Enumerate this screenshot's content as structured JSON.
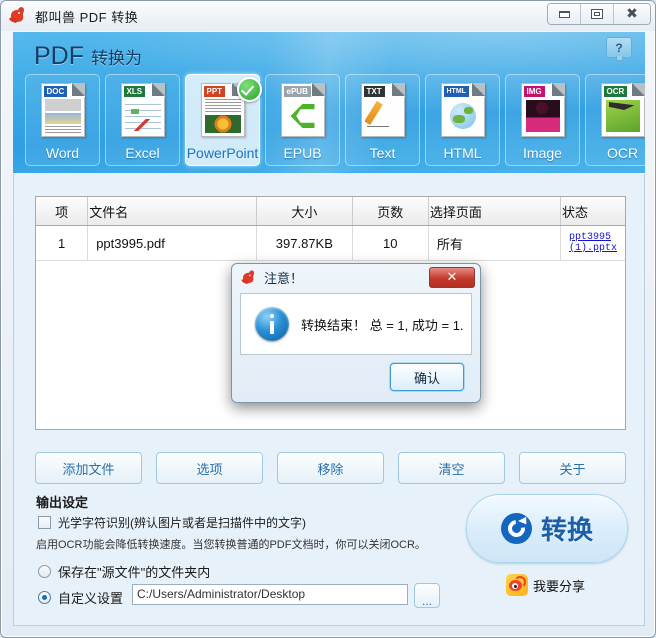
{
  "window": {
    "title": "都叫兽 PDF 转换",
    "app_icon": "kangaroo-logo-icon",
    "controls": {
      "minimize": "minimize-icon",
      "maximize": "maximize-icon",
      "close": "close-icon"
    }
  },
  "header": {
    "title_main": "PDF",
    "title_sub": "转换为",
    "help_label": "?",
    "tiles": [
      {
        "label": "Word",
        "tag": "DOC",
        "tag_color": "#1f5fb4",
        "active": false
      },
      {
        "label": "Excel",
        "tag": "XLS",
        "tag_color": "#1d7a3c",
        "active": false
      },
      {
        "label": "PowerPoint",
        "tag": "PPT",
        "tag_color": "#d04423",
        "active": true
      },
      {
        "label": "EPUB",
        "tag": "ePUB",
        "tag_color": "#9aa3ab",
        "active": false
      },
      {
        "label": "Text",
        "tag": "TXT",
        "tag_color": "#2f3439",
        "active": false
      },
      {
        "label": "HTML",
        "tag": "HTML",
        "tag_color": "#1f5fb4",
        "active": false
      },
      {
        "label": "Image",
        "tag": "IMG",
        "tag_color": "#c3136e",
        "active": false
      },
      {
        "label": "OCR",
        "tag": "OCR",
        "tag_color": "#1d7a3c",
        "active": false
      }
    ]
  },
  "file_table": {
    "columns": [
      "项",
      "文件名",
      "大小",
      "页数",
      "选择页面",
      "状态"
    ],
    "rows": [
      {
        "index": "1",
        "filename": "ppt3995.pdf",
        "size": "397.87KB",
        "pages": "10",
        "selected_pages": "所有",
        "status_link_line1": "ppt3995",
        "status_link_line2": "(1).pptx"
      }
    ]
  },
  "actions": [
    {
      "label": "添加文件"
    },
    {
      "label": "选项"
    },
    {
      "label": "移除"
    },
    {
      "label": "清空"
    },
    {
      "label": "关于"
    }
  ],
  "output_settings": {
    "section_title": "输出设定",
    "ocr_label": "光学字符识别(辨认图片或者是扫描件中的文字)",
    "ocr_checked": false,
    "hint": "启用OCR功能会降低转换速度。当您转换普通的PDF文档时，你可以关闭OCR。",
    "radio_source_label": "保存在\"源文件\"的文件夹内",
    "radio_custom_label": "自定义设置",
    "selected_radio": "custom",
    "path_value": "C:/Users/Administrator/Desktop",
    "browse_label": "..."
  },
  "convert": {
    "label": "转换",
    "icon": "refresh-circle-icon",
    "share_label": "我要分享",
    "share_icon": "weibo-icon"
  },
  "dialog": {
    "title": "注意！",
    "message": "转换结束！ 总 = 1, 成功 = 1.",
    "ok_label": "确认",
    "close_label": "✕",
    "icon": "info-icon"
  },
  "colors": {
    "header_blue": "#3aa8e6",
    "accent_blue": "#1b5fa8",
    "link_blue": "#1414cf",
    "panel_bg": "#e7f1f9"
  }
}
